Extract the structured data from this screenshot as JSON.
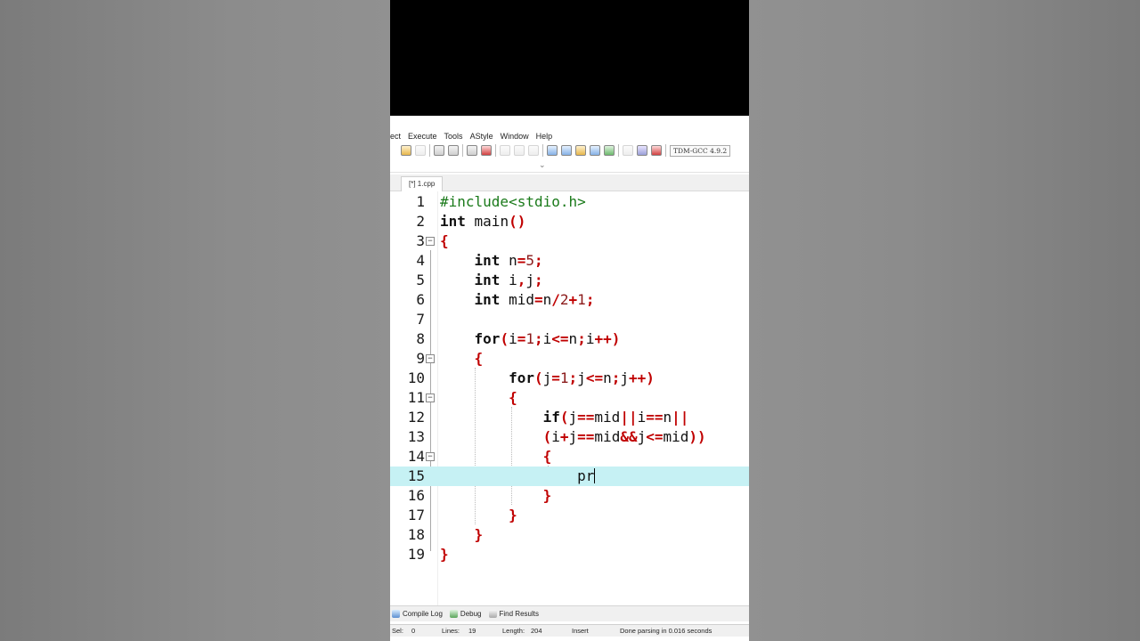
{
  "menu": [
    "ect",
    "Execute",
    "Tools",
    "AStyle",
    "Window",
    "Help"
  ],
  "compiler": "TDM-GCC 4.9.2",
  "tab": "[*] 1.cpp",
  "lines": [
    {
      "n": "1",
      "text": "#include<stdio.h>"
    },
    {
      "n": "2",
      "text": "int main()"
    },
    {
      "n": "3",
      "text": "{"
    },
    {
      "n": "4",
      "text": "    int n=5;"
    },
    {
      "n": "5",
      "text": "    int i,j;"
    },
    {
      "n": "6",
      "text": "    int mid=n/2+1;"
    },
    {
      "n": "7",
      "text": ""
    },
    {
      "n": "8",
      "text": "    for(i=1;i<=n;i++)"
    },
    {
      "n": "9",
      "text": "    {"
    },
    {
      "n": "10",
      "text": "        for(j=1;j<=n;j++)"
    },
    {
      "n": "11",
      "text": "        {"
    },
    {
      "n": "12",
      "text": "            if(j==mid||i==n||"
    },
    {
      "n": "13",
      "text": "            (i+j==mid&&j<=mid))"
    },
    {
      "n": "14",
      "text": "            {"
    },
    {
      "n": "15",
      "text": "                pr"
    },
    {
      "n": "16",
      "text": "            }"
    },
    {
      "n": "17",
      "text": "        }"
    },
    {
      "n": "18",
      "text": "    }"
    },
    {
      "n": "19",
      "text": "}"
    }
  ],
  "bottom_tabs": {
    "compile_log": "Compile Log",
    "debug": "Debug",
    "find_results": "Find Results"
  },
  "status": {
    "sel_label": "Sel:",
    "sel": "0",
    "lines_label": "Lines:",
    "lines": "19",
    "length_label": "Length:",
    "length": "204",
    "mode": "Insert",
    "message": "Done parsing in 0.016 seconds"
  }
}
